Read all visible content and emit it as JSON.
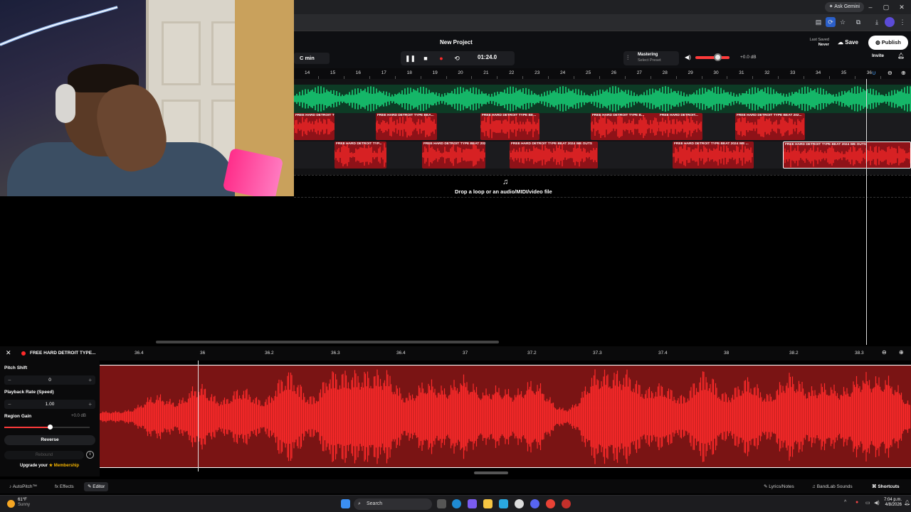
{
  "browser": {
    "ask_gemini": "Ask Gemini",
    "min": "–",
    "max": "▢",
    "close": "✕"
  },
  "daw": {
    "project_title": "New Project",
    "key": "C min",
    "time": "01:24.0",
    "mastering_title": "Mastering",
    "mastering_preset": "Select Preset",
    "volume_db": "+0.0 dB",
    "last_saved_label": "Last Saved",
    "last_saved_value": "Never",
    "save": "Save",
    "publish": "Publish",
    "invite": "Invite"
  },
  "ruler_ticks": [
    "14",
    "15",
    "16",
    "17",
    "18",
    "19",
    "20",
    "21",
    "22",
    "23",
    "24",
    "25",
    "26",
    "27",
    "28",
    "29",
    "30",
    "31",
    "32",
    "33",
    "34",
    "35",
    "36"
  ],
  "clips": {
    "row2": [
      "FREE HARD DETROIT TYPE...",
      "FREE HARD DETROIT TYPE BEA...",
      "FREE HARD DETROIT TYPE BE...",
      "FREE HARD DETROIT TYPE B...",
      "FREE HARD DETROIT...",
      "FREE HARD DETROIT TYPE BEAT 202..."
    ],
    "row3": [
      "FREE HARD DETROIT TYP...",
      "FREE HARD DETROIT TYPE BEAT 202...",
      "FREE HARD DETROIT TYPE BEAT 2024 WE OUTS",
      "FREE HARD DETROIT TYPE BEAT 2024 WE ...",
      "FREE HARD DETROIT TYPE BEAT 2024 WE OUTS"
    ]
  },
  "drop_zone": "Drop a loop or an audio/MIDI/video file",
  "editor": {
    "region_name": "FREE HARD DETROIT TYPE...",
    "ticks": [
      "36.4",
      "36",
      "36.2",
      "36.3",
      "36.4",
      "37",
      "37.2",
      "37.3",
      "37.4",
      "38",
      "38.2",
      "38.3"
    ],
    "pitch_shift_label": "Pitch Shift",
    "pitch_shift_value": "0",
    "playback_rate_label": "Playback Rate (Speed)",
    "playback_rate_value": "1.00",
    "region_gain_label": "Region Gain",
    "region_gain_value": "+0.0 dB",
    "reverse": "Reverse",
    "rebound": "Rebound",
    "upgrade_prefix": "Upgrade your",
    "membership": "Membership"
  },
  "bottom_tabs": {
    "autopitch": "AutoPitch™",
    "effects": "Effects",
    "editor": "Editor",
    "lyrics": "Lyrics/Notes",
    "bandlab_sounds": "BandLab Sounds",
    "shortcuts": "Shortcuts"
  },
  "taskbar": {
    "temp": "61°F",
    "weather": "Sunny",
    "search": "Search",
    "time": "7:04 p.m.",
    "date": "4/8/2026"
  },
  "colors": {
    "accent_red": "#ff2a2a",
    "track_green": "#18e07f",
    "clip_red": "#b3121a"
  }
}
